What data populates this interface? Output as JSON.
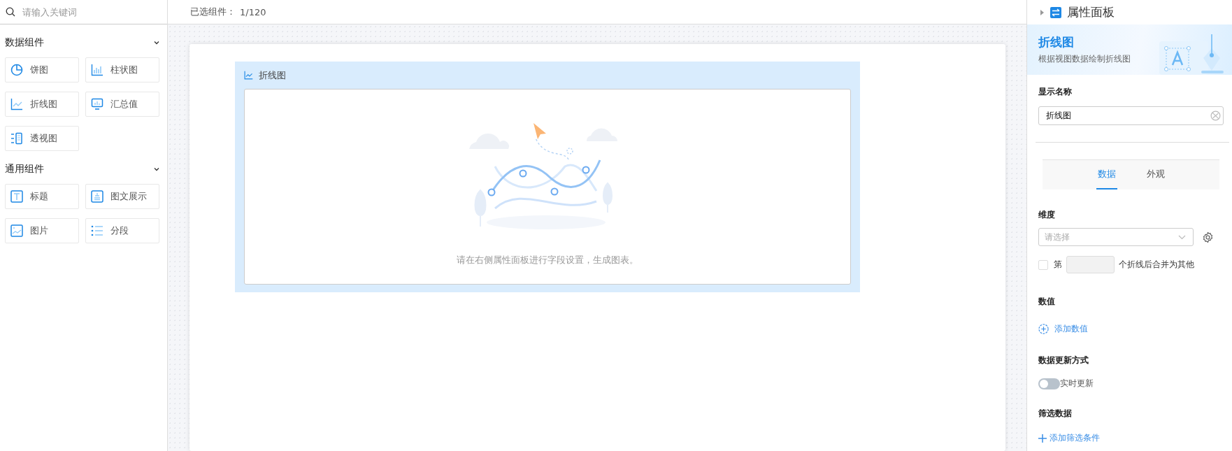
{
  "search": {
    "placeholder": "请输入关键词"
  },
  "sidebar": {
    "groups": [
      {
        "title": "数据组件",
        "expanded": true,
        "items": [
          {
            "label": "饼图",
            "kind": "pie"
          },
          {
            "label": "柱状图",
            "kind": "bar"
          },
          {
            "label": "折线图",
            "kind": "line"
          },
          {
            "label": "汇总值",
            "kind": "summary"
          },
          {
            "label": "透视图",
            "kind": "pivot"
          }
        ]
      },
      {
        "title": "通用组件",
        "expanded": true,
        "items": [
          {
            "label": "标题",
            "kind": "title"
          },
          {
            "label": "图文展示",
            "kind": "richtext"
          },
          {
            "label": "图片",
            "kind": "image"
          },
          {
            "label": "分段",
            "kind": "list"
          }
        ]
      }
    ]
  },
  "toolbar": {
    "selected_label": "已选组件：",
    "selected_count": "1/120"
  },
  "canvas": {
    "widget": {
      "title": "折线图",
      "empty_message": "请在右侧属性面板进行字段设置，生成图表。"
    }
  },
  "panel": {
    "title": "属性面板",
    "banner_title": "折线图",
    "banner_subtitle": "根据视图数据绘制折线图",
    "display_name_label": "显示名称",
    "display_name_value": "折线图",
    "tabs": [
      {
        "label": "数据",
        "selected": true
      },
      {
        "label": "外观",
        "selected": false
      }
    ],
    "dimension_label": "维度",
    "dimension_placeholder": "请选择",
    "merge": {
      "checked": false,
      "prefix": "第",
      "suffix": "个折线后合并为其他"
    },
    "value_label": "数值",
    "add_value": "添加数值",
    "update_label": "数据更新方式",
    "realtime": {
      "on": false,
      "label": "实时更新"
    },
    "filter_label": "筛选数据",
    "add_filter": "添加筛选条件"
  }
}
